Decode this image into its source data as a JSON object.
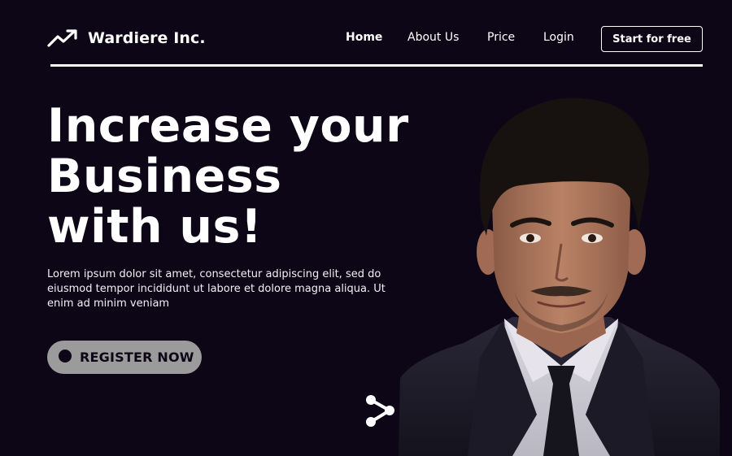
{
  "brand": {
    "name": "Wardiere Inc.",
    "logo_icon": "trending-up-icon"
  },
  "nav": {
    "items": [
      {
        "label": "Home",
        "active": true
      },
      {
        "label": "About Us",
        "active": false
      },
      {
        "label": "Price",
        "active": false
      },
      {
        "label": "Login",
        "active": false
      }
    ],
    "cta_label": "Start for free"
  },
  "hero": {
    "title_lines": [
      "Increase your",
      "Business",
      "with us!"
    ],
    "description": "Lorem ipsum dolor sit amet, consectetur adipiscing elit, sed do eiusmod tempor incididunt ut labore et dolore magna aliqua. Ut enim ad minim veniam",
    "register_label": "REGISTER NOW",
    "share_icon": "share-icon"
  },
  "colors": {
    "background": "#0d0617",
    "text": "#ffffff",
    "button_gray": "#9b9b9b"
  }
}
